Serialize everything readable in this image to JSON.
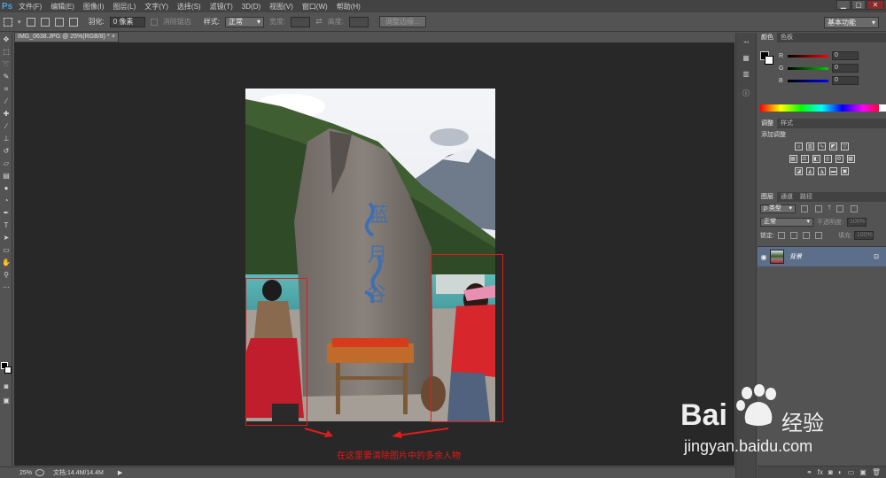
{
  "app": {
    "logo": "Ps"
  },
  "menu": {
    "items": [
      "文件(F)",
      "编辑(E)",
      "图像(I)",
      "图层(L)",
      "文字(Y)",
      "选择(S)",
      "滤镜(T)",
      "3D(D)",
      "视图(V)",
      "窗口(W)",
      "帮助(H)"
    ]
  },
  "window_controls": {
    "minimize": "▁",
    "maximize": "▢",
    "close": "✕"
  },
  "options": {
    "feather_label": "羽化:",
    "feather_value": "0 像素",
    "antialias_label": "消除锯齿",
    "style_label": "样式:",
    "style_value": "正常",
    "width_label": "宽度:",
    "height_label": "高度:",
    "refine_edge": "调整边缘...",
    "workspace": "基本功能"
  },
  "document": {
    "tab_title": "IMG_0638.JPG @ 25%(RGB/8) *",
    "close": "×"
  },
  "annotation": {
    "text": "在这里要清除图片中的多余人物"
  },
  "status": {
    "zoom": "25%",
    "doc_size": "文档:14.4M/14.4M",
    "arrow": "▶"
  },
  "panels": {
    "color_tabs": [
      "颜色",
      "色板"
    ],
    "rgb": [
      {
        "label": "R",
        "value": "0"
      },
      {
        "label": "G",
        "value": "0"
      },
      {
        "label": "B",
        "value": "0"
      }
    ],
    "adjust_tabs": [
      "调整",
      "样式"
    ],
    "add_adjustment": "添加调整",
    "layer_tabs": [
      "图层",
      "通道",
      "路径"
    ],
    "kind_filter": "ρ 类型",
    "blend_mode": "正常",
    "opacity_label": "不透明度:",
    "opacity_value": "100%",
    "lock_label": "锁定:",
    "fill_label": "填充:",
    "fill_value": "100%",
    "layer_name": "背景"
  },
  "watermark": {
    "brand": "Bai",
    "brand2": "经验",
    "url": "jingyan.baidu.com"
  },
  "colors": {
    "red_annotation": "#e21b1b",
    "selected_layer": "#5b6f8a"
  }
}
